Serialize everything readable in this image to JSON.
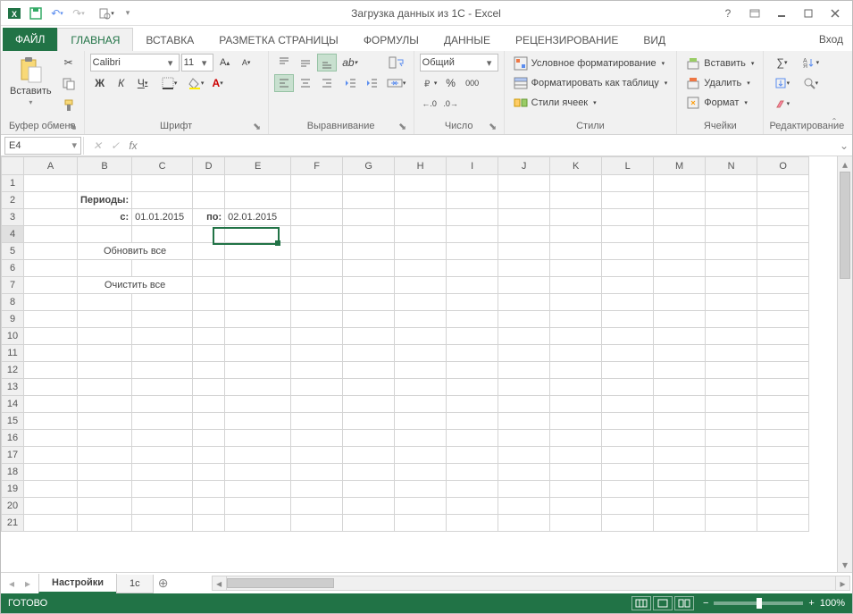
{
  "title": "Загрузка данных из 1С - Excel",
  "signin": "Вход",
  "tabs": {
    "file": "ФАЙЛ",
    "home": "ГЛАВНАЯ",
    "insert": "ВСТАВКА",
    "layout": "РАЗМЕТКА СТРАНИЦЫ",
    "formulas": "ФОРМУЛЫ",
    "data": "ДАННЫЕ",
    "review": "РЕЦЕНЗИРОВАНИЕ",
    "view": "ВИД"
  },
  "ribbon": {
    "clipboard": {
      "label": "Буфер обмена",
      "paste": "Вставить"
    },
    "font": {
      "label": "Шрифт",
      "name": "Calibri",
      "size": "11",
      "bold": "Ж",
      "italic": "К",
      "underline": "Ч"
    },
    "align": {
      "label": "Выравнивание"
    },
    "number": {
      "label": "Число",
      "format": "Общий"
    },
    "styles": {
      "label": "Стили",
      "cond": "Условное форматирование",
      "table": "Форматировать как таблицу",
      "cell": "Стили ячеек"
    },
    "cells": {
      "label": "Ячейки",
      "insert": "Вставить",
      "delete": "Удалить",
      "format": "Формат"
    },
    "editing": {
      "label": "Редактирование"
    }
  },
  "namebox": "E4",
  "columns": [
    "A",
    "B",
    "C",
    "D",
    "E",
    "F",
    "G",
    "H",
    "I",
    "J",
    "K",
    "L",
    "M",
    "N",
    "O"
  ],
  "rows": [
    "1",
    "2",
    "3",
    "4",
    "5",
    "6",
    "7",
    "8",
    "9",
    "10",
    "11",
    "12",
    "13",
    "14",
    "15",
    "16",
    "17",
    "18",
    "19",
    "20",
    "21"
  ],
  "cells": {
    "B2": "Периоды:",
    "B3": "с:",
    "C3": "01.01.2015",
    "D3": "по:",
    "E3": "02.01.2015",
    "btn_refresh": "Обновить все",
    "btn_clear": "Очистить все"
  },
  "sheets": {
    "active": "Настройки",
    "other": "1с"
  },
  "status": {
    "ready": "ГОТОВО",
    "zoom": "100%"
  }
}
